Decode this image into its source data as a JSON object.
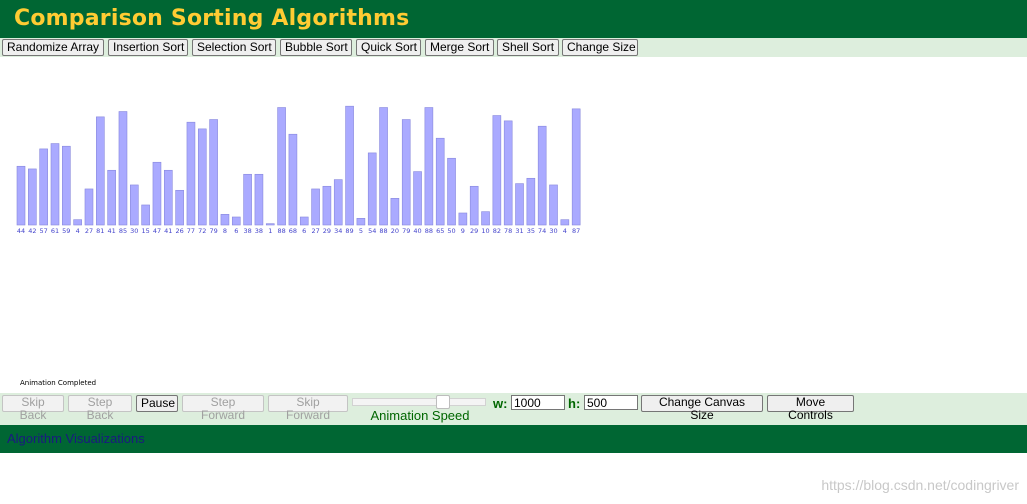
{
  "header": {
    "title": "Comparison Sorting Algorithms"
  },
  "toolbar": {
    "buttons": [
      "Randomize Array",
      "Insertion Sort",
      "Selection Sort",
      "Bubble Sort",
      "Quick Sort",
      "Merge Sort",
      "Shell Sort",
      "Change Size"
    ]
  },
  "canvas": {
    "bar_color": "#aaaaff",
    "bar_border": "#8888dd",
    "label_color": "#4444cc",
    "values": [
      44,
      42,
      57,
      61,
      59,
      4,
      27,
      81,
      41,
      85,
      30,
      15,
      47,
      41,
      26,
      77,
      72,
      79,
      8,
      6,
      38,
      38,
      1,
      88,
      68,
      6,
      27,
      29,
      34,
      89,
      5,
      54,
      88,
      20,
      79,
      40,
      88,
      65,
      50,
      9,
      29,
      10,
      82,
      78,
      31,
      35,
      74,
      30,
      4,
      87
    ],
    "status": "Animation Completed"
  },
  "controls": {
    "skip_back": "Skip Back",
    "step_back": "Step Back",
    "pause": "Pause",
    "step_forward": "Step Forward",
    "skip_forward": "Skip Forward",
    "speed_label": "Animation Speed",
    "speed_fraction": 0.7,
    "width_label": "w:",
    "width_value": "1000",
    "height_label": "h:",
    "height_value": "500",
    "change_canvas": "Change Canvas Size",
    "move_controls": "Move Controls"
  },
  "footer": {
    "link": "Algorithm Visualizations"
  },
  "watermark": "https://blog.csdn.net/codingriver"
}
